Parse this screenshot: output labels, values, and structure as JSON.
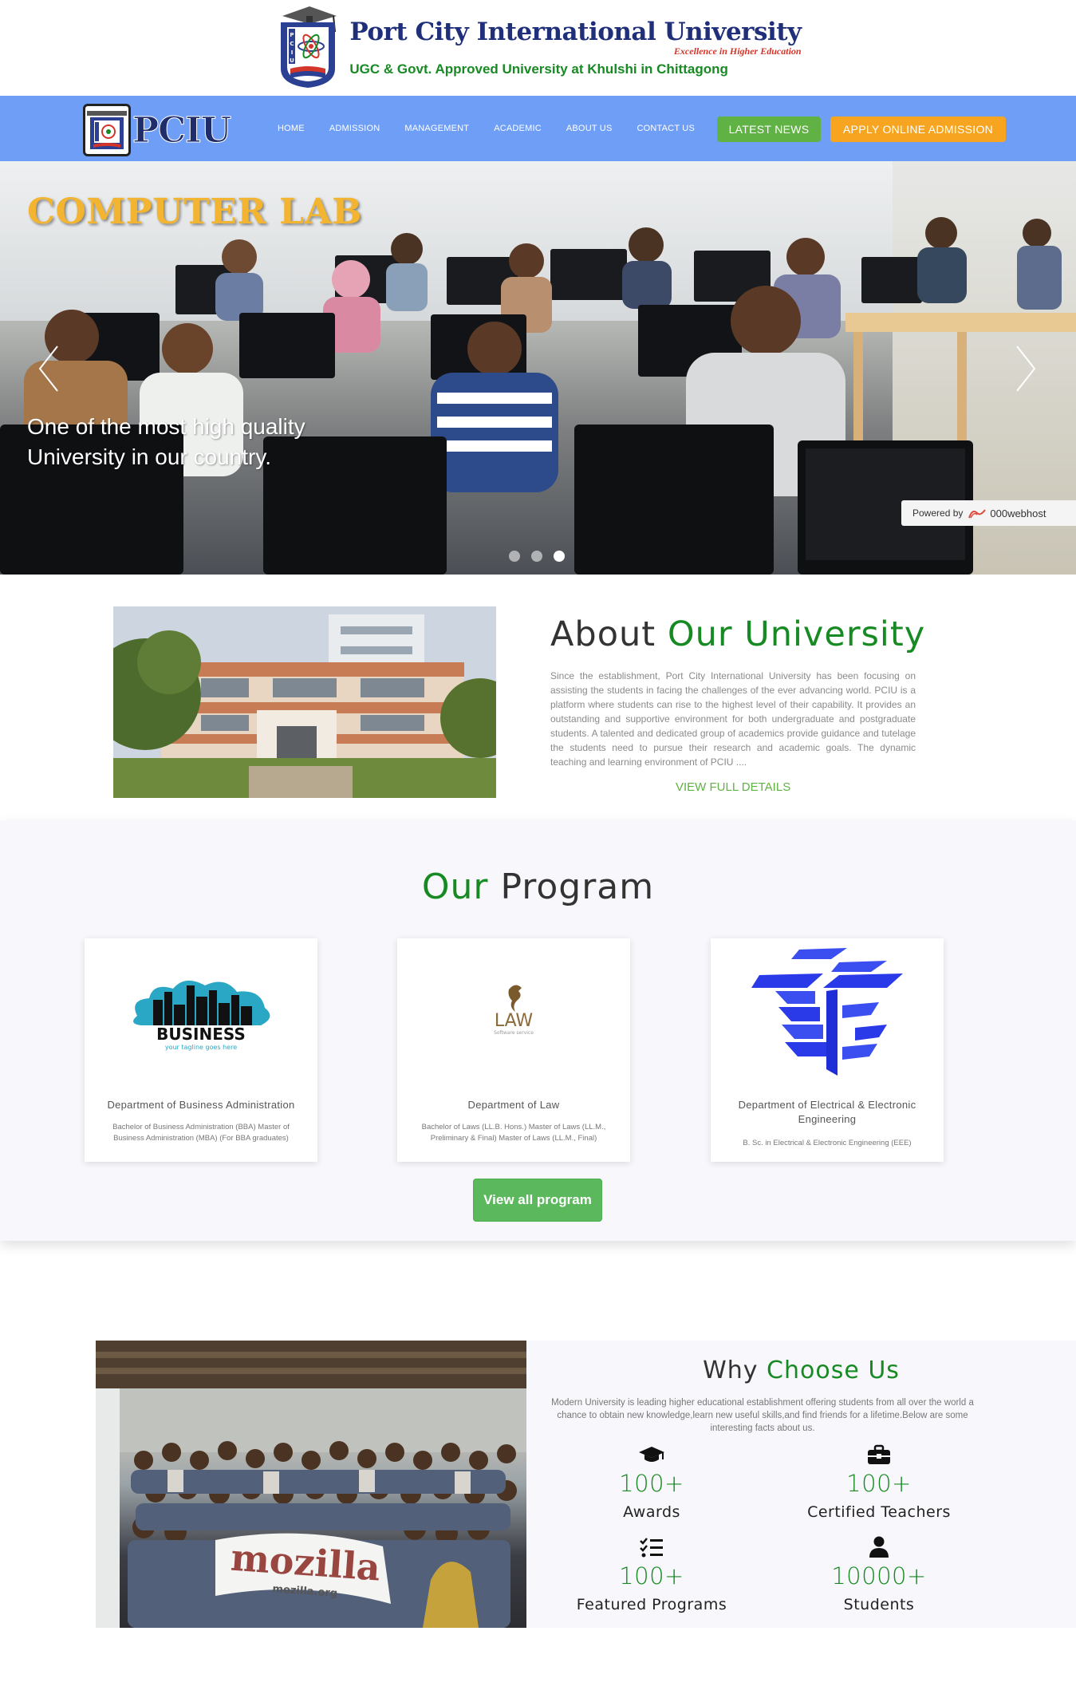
{
  "header": {
    "university_name": "Port City International University",
    "tagline": "Excellence in Higher Education",
    "approval": "UGC & Govt. Approved University at Khulshi in Chittagong",
    "crest_letters": "PCIU"
  },
  "navbar": {
    "logo_text": "PCIU",
    "links": [
      "HOME",
      "ADMISSION",
      "MANAGEMENT",
      "ACADEMIC",
      "ABOUT US",
      "CONTACT US"
    ],
    "latest_news": "LATEST NEWS",
    "apply": "APPLY ONLINE ADMISSION",
    "bg_color": "#6f9ef7",
    "news_color": "#5fb243",
    "apply_color": "#f7a520"
  },
  "hero": {
    "title": "COMPUTER LAB",
    "caption": "One of the most high quality University in our country.",
    "slide_count": 3,
    "active_slide": 3,
    "powered_by": "Powered by",
    "host_brand": "000webhost"
  },
  "about": {
    "title_part1": "About",
    "title_part2": "Our University",
    "text": "Since the establishment, Port City International University has been focusing on assisting the students in facing the challenges of the ever advancing world. PCIU is a platform where students can rise to the highest level of their capability. It provides an outstanding and supportive environment for both undergraduate and postgraduate students. A talented and dedicated group of academics provide guidance and tutelage the students need to pursue their research and academic goals. The dynamic teaching and learning environment of PCIU ....",
    "link": "VIEW FULL DETAILS"
  },
  "program": {
    "title_part1": "Our",
    "title_part2": "Program",
    "cards": [
      {
        "logo_text": "BUSINESS",
        "logo_sub": "your tagline goes here",
        "title": "Department of Business Administration",
        "desc": "Bachelor of Business Administration (BBA) Master of Business Administration (MBA) (For BBA graduates)"
      },
      {
        "logo_text": "LAW",
        "logo_sub": "Software service",
        "title": "Department of Law",
        "desc": "Bachelor of Laws (LL.B. Hons.) Master of Laws (LL.M., Preliminary & Final) Master of Laws (LL.M., Final)"
      },
      {
        "logo_text": "",
        "logo_sub": "",
        "title": "Department of Electrical & Electronic Engineering",
        "desc": "B. Sc. in Electrical & Electronic Engineering (EEE)"
      }
    ],
    "view_all": "View all program"
  },
  "why": {
    "title_part1": "Why",
    "title_part2": "Choose Us",
    "text": "Modern University is leading higher educational establishment offering students from all over the world a chance to obtain new knowledge,learn new useful skills,and find friends for a lifetime.Below are some interesting facts about us.",
    "banner_text": "mozilla",
    "banner_sub": "mozilla.org",
    "stats": [
      {
        "icon": "graduation-cap-icon",
        "number": "100+",
        "label": "Awards"
      },
      {
        "icon": "briefcase-icon",
        "number": "100+",
        "label": "Certified Teachers"
      },
      {
        "icon": "list-check-icon",
        "number": "100+",
        "label": "Featured Programs"
      },
      {
        "icon": "user-icon",
        "number": "10000+",
        "label": "Students"
      }
    ]
  }
}
